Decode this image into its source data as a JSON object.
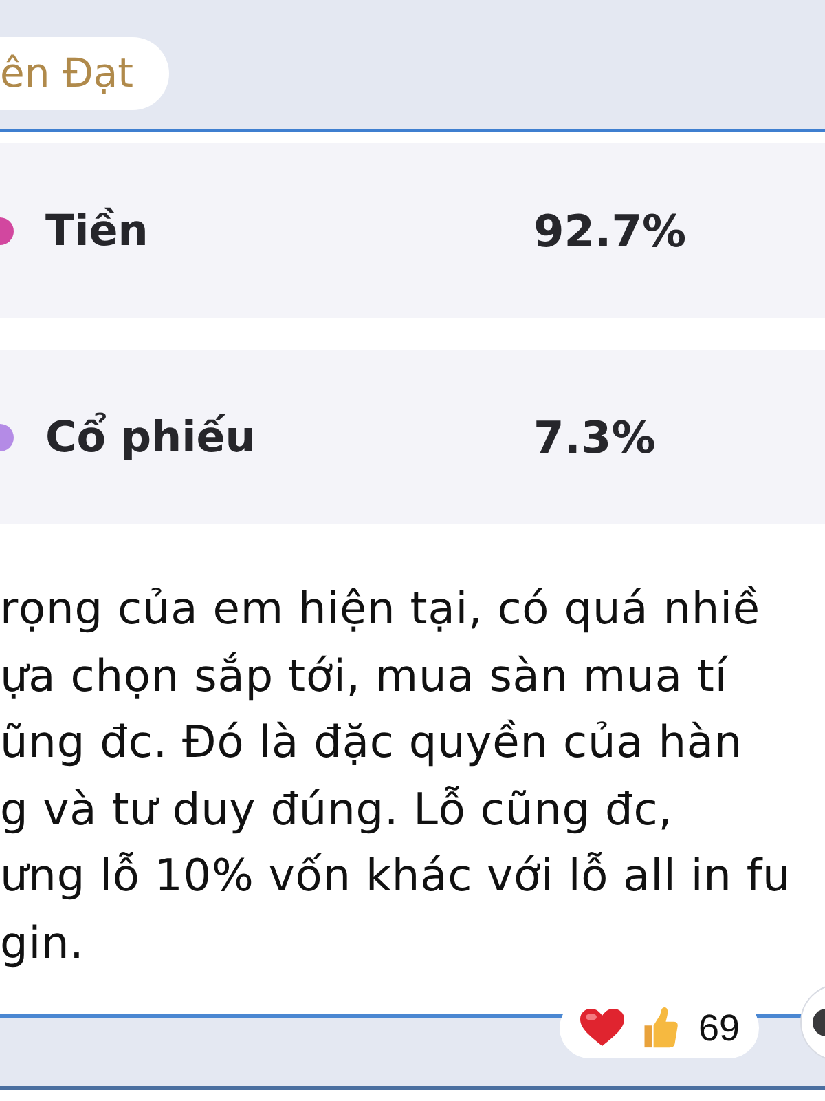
{
  "header": {
    "name": "ên Đạt"
  },
  "allocations": [
    {
      "label": "Tiền",
      "value": "92.7%",
      "color": "#d2479f"
    },
    {
      "label": "Cổ phiếu",
      "value": "7.3%",
      "color": "#b48be6"
    }
  ],
  "message": {
    "text": "rọng của em hiện tại, có quá nhiề\nựa chọn sắp tới, mua sàn mua tí\nũng đc. Đó là đặc quyền của hàn\ng và tư duy đúng. Lỗ cũng đc,\nưng lỗ 10% vốn khác với lỗ all in fu\ngin."
  },
  "reactions": {
    "count": "69"
  }
}
